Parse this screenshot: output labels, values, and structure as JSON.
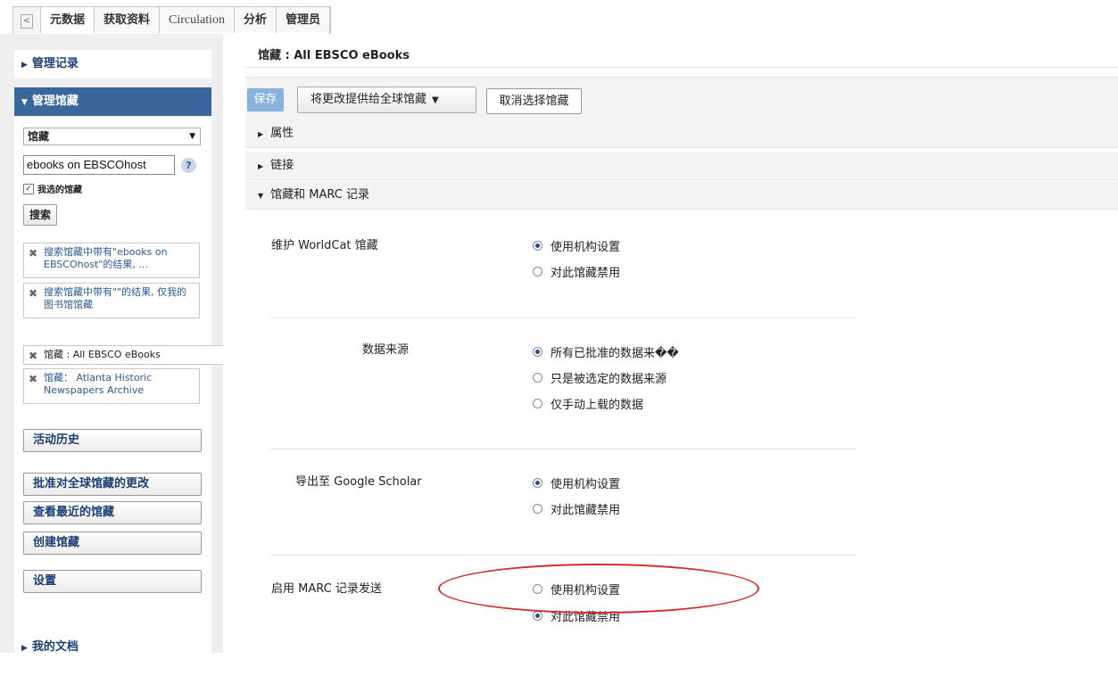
{
  "top_tabs": {
    "collapse_glyph": "<",
    "items": [
      "元数据",
      "获取资料",
      "Circulation",
      "分析",
      "管理员"
    ]
  },
  "sidebar": {
    "manage_records": "管理记录",
    "manage_collections": "管理馆藏",
    "search_type": "馆藏",
    "search_value": "ebooks on EBSCOhost",
    "help": "?",
    "my_selected": "我选的馆藏",
    "search_button": "搜索",
    "recent_searches": [
      "搜索馆藏中带有\"ebooks on EBSCOhost\"的结果, ...",
      "搜索馆藏中带有\"\"的结果, 仅我的图书馆馆藏"
    ],
    "opened_collections": [
      "馆藏 : All EBSCO eBooks",
      "馆藏： Atlanta Historic Newspapers Archive"
    ],
    "activity_history": "活动历史",
    "action_buttons": [
      "批准对全球馆藏的更改",
      "查看最近的馆藏",
      "创建馆藏"
    ],
    "settings": "设置",
    "my_files": "我的文档"
  },
  "main": {
    "title": "馆藏 : All EBSCO eBooks",
    "toolbar": {
      "save": "保存",
      "offer_global": "将更改提供给全球馆藏",
      "cancel_select": "取消选择馆藏"
    },
    "sections": {
      "attributes": "属性",
      "links": "链接",
      "holdings_marc": "馆藏和 MARC 记录"
    },
    "settings": [
      {
        "label": "维护 WorldCat 馆藏",
        "options": [
          {
            "label": "使用机构设置",
            "selected": true
          },
          {
            "label": "对此馆藏禁用",
            "selected": false
          }
        ]
      },
      {
        "label": "数据来源",
        "options": [
          {
            "label": "所有已批准的数据来��",
            "selected": true
          },
          {
            "label": "只是被选定的数据来源",
            "selected": false
          },
          {
            "label": "仅手动上载的数据",
            "selected": false
          }
        ]
      },
      {
        "label": "导出至 Google Scholar",
        "options": [
          {
            "label": "使用机构设置",
            "selected": true
          },
          {
            "label": "对此馆藏禁用",
            "selected": false
          }
        ]
      },
      {
        "label": "启用 MARC 记录发送",
        "options": [
          {
            "label": "使用机构设置",
            "selected": false
          },
          {
            "label": "对此馆藏禁用",
            "selected": true
          }
        ]
      }
    ]
  },
  "colors": {
    "sidebar_active": "#39679b",
    "link_blue": "#1b3f73",
    "save_button": "#88b3de",
    "annotation": "#d42c2c"
  }
}
